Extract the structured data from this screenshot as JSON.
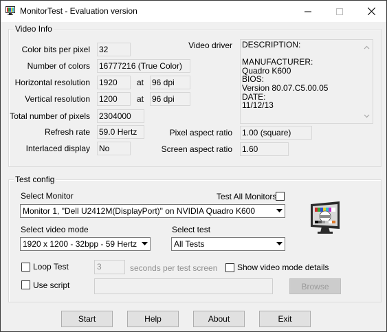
{
  "window": {
    "title": "MonitorTest - Evaluation version",
    "app_icon": "monitor-test-icon"
  },
  "video_info": {
    "legend": "Video Info",
    "color_bits_label": "Color bits per pixel",
    "color_bits_value": "32",
    "num_colors_label": "Number of colors",
    "num_colors_value": "16777216 (True Color)",
    "h_res_label": "Horizontal resolution",
    "h_res_value": "1920",
    "h_at": "at",
    "h_dpi": "96 dpi",
    "v_res_label": "Vertical resolution",
    "v_res_value": "1200",
    "v_at": "at",
    "v_dpi": "96 dpi",
    "total_pixels_label": "Total number of pixels",
    "total_pixels_value": "2304000",
    "refresh_label": "Refresh rate",
    "refresh_value": "59.0 Hertz",
    "interlaced_label": "Interlaced display",
    "interlaced_value": "No",
    "video_driver_label": "Video driver",
    "video_driver_lines": [
      "DESCRIPTION:",
      "",
      "MANUFACTURER:",
      "Quadro K600",
      "BIOS:",
      "Version 80.07.C5.00.05",
      "DATE:",
      "11/12/13"
    ],
    "pixel_aspect_label": "Pixel aspect ratio",
    "pixel_aspect_value": "1.00 (square)",
    "screen_aspect_label": "Screen aspect ratio",
    "screen_aspect_value": "1.60"
  },
  "test_config": {
    "legend": "Test config",
    "select_monitor_label": "Select Monitor",
    "test_all_label": "Test All Monitors",
    "test_all_checked": false,
    "monitor_value": "Monitor 1, \"Dell U2412M(DisplayPort)\" on NVIDIA Quadro K600",
    "video_mode_label": "Select video mode",
    "video_mode_value": "1920 x 1200 - 32bpp - 59 Hertz",
    "select_test_label": "Select test",
    "select_test_value": "All Tests",
    "loop_test_label": "Loop Test",
    "loop_test_checked": false,
    "seconds_value": "3",
    "seconds_label": "seconds per test screen",
    "show_details_label": "Show video mode details",
    "show_details_checked": false,
    "use_script_label": "Use script",
    "use_script_checked": false,
    "script_path": "",
    "browse_label": "Browse",
    "test_pattern_icon": "monitor-test-pattern-icon"
  },
  "buttons": {
    "start": "Start",
    "help": "Help",
    "about": "About",
    "exit": "Exit"
  },
  "colors": {
    "window_bg": "#f0f0f0",
    "titlebar_bg": "#ffffff",
    "button_bg": "#e1e1e1",
    "disabled_text": "#9a9a9a"
  }
}
